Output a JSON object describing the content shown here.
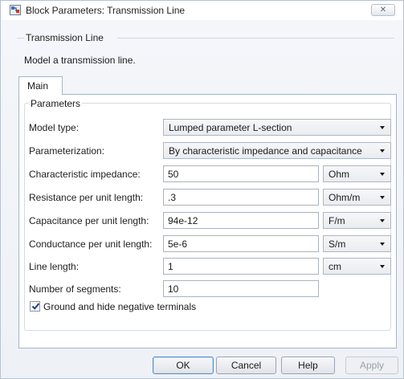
{
  "window": {
    "title": "Block Parameters: Transmission Line",
    "close_glyph": "✕"
  },
  "block": {
    "name": "Transmission Line",
    "description": "Model a transmission line."
  },
  "tabs": [
    {
      "label": "Main"
    }
  ],
  "parameters": {
    "legend": "Parameters",
    "model_type": {
      "label": "Model type:",
      "value": "Lumped parameter L-section"
    },
    "parameterization": {
      "label": "Parameterization:",
      "value": "By characteristic impedance and capacitance"
    },
    "characteristic_impedance": {
      "label": "Characteristic impedance:",
      "value": "50",
      "unit": "Ohm"
    },
    "resistance": {
      "label": "Resistance per unit length:",
      "value": ".3",
      "unit": "Ohm/m"
    },
    "capacitance": {
      "label": "Capacitance per unit length:",
      "value": "94e-12",
      "unit": "F/m"
    },
    "conductance": {
      "label": "Conductance per unit length:",
      "value": "5e-6",
      "unit": "S/m"
    },
    "line_length": {
      "label": "Line length:",
      "value": "1",
      "unit": "cm"
    },
    "segments": {
      "label": "Number of segments:",
      "value": "10"
    },
    "ground_checkbox": {
      "label": "Ground and hide negative terminals",
      "checked": true
    }
  },
  "buttons": {
    "ok": "OK",
    "cancel": "Cancel",
    "help": "Help",
    "apply": "Apply"
  }
}
